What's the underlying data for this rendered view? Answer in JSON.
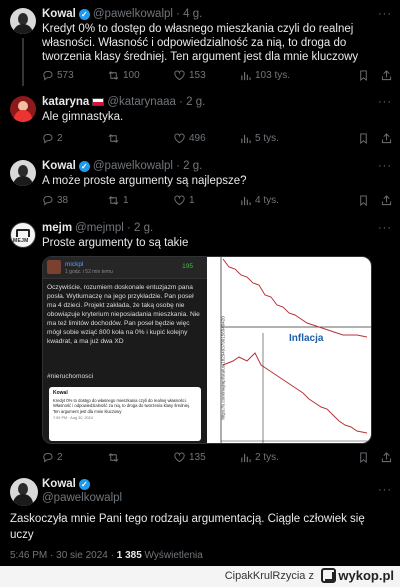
{
  "tweets": [
    {
      "name": "Kowal",
      "handle": "@pawelkowalpl · 4 g.",
      "text": "Kredyt 0% to dostęp do własnego mieszkania czyli do realnej własności. Własność i odpowiedzialność za nią, to droga do tworzenia klasy średniej. Ten argument jest dla mnie kluczowy",
      "replies": "573",
      "reposts": "100",
      "likes": "153",
      "views": "103 tys."
    },
    {
      "name": "kataryna",
      "handle": "@katarynaaa · 2 g.",
      "text": "Ale gimnastyka.",
      "replies": "2",
      "reposts": "",
      "likes": "496",
      "views": "5 tys."
    },
    {
      "name": "Kowal",
      "handle": "@pawelkowalpl · 2 g.",
      "text": "A może proste argumenty są najlepsze?",
      "replies": "38",
      "reposts": "1",
      "likes": "1",
      "views": "4 tys."
    },
    {
      "name": "mejm",
      "handle": "@mejmpl · 2 g.",
      "text": "Proste argumenty to są takie",
      "replies": "2",
      "reposts": "",
      "likes": "135",
      "views": "2 tys."
    }
  ],
  "media": {
    "left": {
      "user": "mickpl",
      "time": "1 godz. i 52 min temu",
      "score": "195",
      "text": "Oczywiście, rozumiem doskonale entuzjazm pana posła. Wytłumaczę na jego przykładzie. Pan poseł ma 4 dzieci. Projekt zakłada, że taką osobę nie obowiązuje kryterium nieposiadania mieszkania. Nie ma też limitów dochodów. Pan poseł będzie więc mógł sobie wziąć 800 koła na 0% i kupić kolejny kwadrat, a ma już dwa XD",
      "tag": "#nieruchomosci",
      "embed_name": "Kowal",
      "embed_text": "Kredyt 0% to dostęp do własnego mieszkania czyli do realnej własności. Własność i odpowiedzialność za nią, to droga do tworzenia klasy średniej. Ten argument jest dla mnie kluczowy",
      "embed_foot": "7:59 PM · Aug 30, 2024"
    },
    "right": {
      "label": "Inflacja",
      "url": "https://x.com/mejmpl/status/1829493790156940420"
    }
  },
  "final": {
    "name": "Kowal",
    "handle": "@pawelkowalpl",
    "text": "Zaskoczyła mnie Pani tego rodzaju argumentacją. Ciągle człowiek się uczy",
    "time": "5:46 PM · 30 sie 2024 · ",
    "views": "1 385",
    "views_label": " Wyświetlenia"
  },
  "footer": {
    "author": "CipakKrulRzycia",
    "sep": "z",
    "site": "wykop.pl"
  },
  "colors": {
    "background": "#000000",
    "verified": "#1d9bf0",
    "text": "#e7e9ea",
    "muted": "#71767b",
    "chart_line": "#b8323a"
  },
  "icons": [
    "reply-icon",
    "repost-icon",
    "like-icon",
    "views-icon",
    "bookmark-icon",
    "share-icon",
    "verified-icon",
    "more-icon"
  ]
}
